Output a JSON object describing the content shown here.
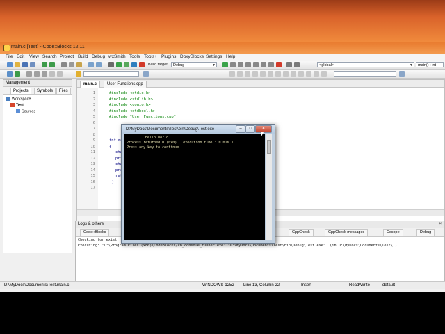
{
  "window": {
    "title": "main.c [Test] - Code::Blocks 12.11"
  },
  "menu": [
    "File",
    "Edit",
    "View",
    "Search",
    "Project",
    "Build",
    "Debug",
    "wxSmith",
    "Tools",
    "Tools+",
    "Plugins",
    "DoxyBlocks",
    "Settings",
    "Help"
  ],
  "toolbar": {
    "build_target_label": "Build target:",
    "build_target_value": "Debug",
    "scope_value": "<global>",
    "function_value": "main() : int"
  },
  "management": {
    "title": "Management",
    "tabs": [
      "Projects",
      "Symbols",
      "Files"
    ],
    "tree": {
      "workspace": "Workspace",
      "project": "Test",
      "folder": "Sources"
    }
  },
  "editor": {
    "tabs": [
      "main.c",
      "User Functions.cpp"
    ],
    "line_numbers": [
      "1",
      "2",
      "3",
      "4",
      "5",
      "6",
      "7",
      "8",
      "9",
      "10",
      "11",
      "12",
      "13",
      "14",
      "15",
      "16",
      "17"
    ],
    "lines": {
      "l1": "#include <stdio.h>",
      "l2": "#include <stdlib.h>",
      "l3": "#include <conio.h>",
      "l4": "#include <stdbool.h>",
      "l5": "#include \"User Functions.cpp\"",
      "l9": "int m",
      "l10": "{",
      "l11": "cha",
      "l12": "pri",
      "l13": "cha",
      "l14": "pri",
      "l15": "ret",
      "l16": "}"
    }
  },
  "console": {
    "title": "D:\\MyDocs\\Documents\\Test\\bin\\Debug\\Test.exe",
    "line1": "Hello World",
    "line2": "Process returned 0 (0x0)   execution time : 0.016 s",
    "line3": "Press any key to continue.",
    "buttons": {
      "minimize": "–",
      "maximize": "□",
      "close": "✕"
    }
  },
  "logs": {
    "title": "Logs & others",
    "close": "×",
    "tabs": [
      "Code::Blocks",
      "CppCheck",
      "CppCheck messages",
      "Cscope",
      "Debug"
    ],
    "line1": "Checking for exist",
    "line2": "Executing: \"C:\\Program Files (x86)\\CodeBlocks/cb_console_runner.exe\" \"D:\\MyDocs\\Documents\\Test\\bin\\Debug\\Test.exe\"  (in D:\\MyDocs\\Documents\\Test\\.)"
  },
  "status": {
    "path": "D:\\MyDocs\\Documents\\Test\\main.c",
    "encoding": "WINDOWS-1252",
    "position": "Line 13, Column 22",
    "mode": "Insert",
    "access": "Read/Write",
    "profile": "default"
  },
  "colors": {
    "titlebar": "#e87a2e",
    "console_bg": "#000000",
    "console_text": "#e7e1b0",
    "code_green": "#008000"
  }
}
